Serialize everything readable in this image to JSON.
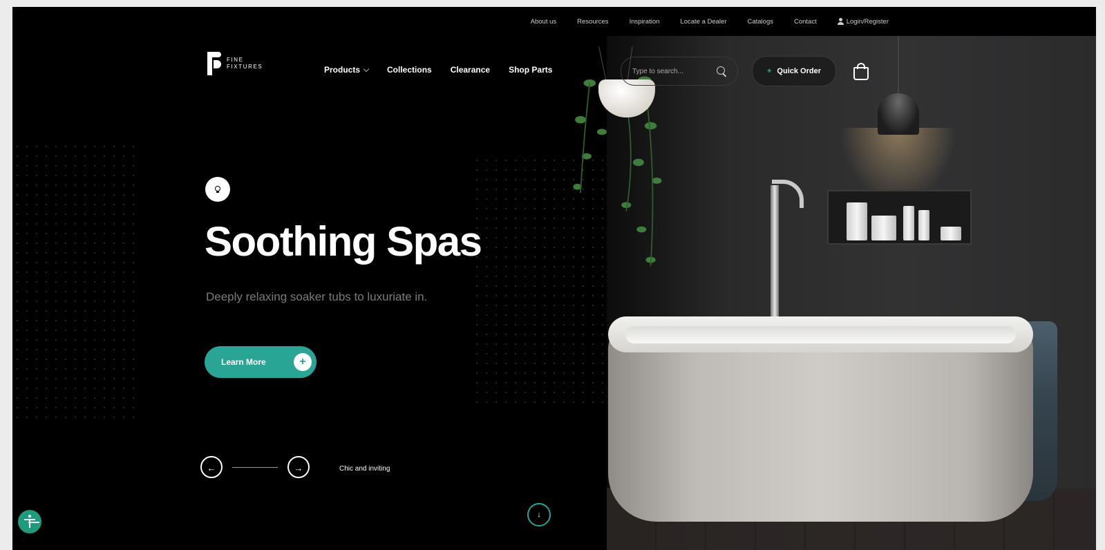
{
  "topbar": {
    "links": [
      "About us",
      "Resources",
      "Inspiration",
      "Locate a Dealer",
      "Catalogs",
      "Contact"
    ],
    "login": "Login/Register"
  },
  "logo": {
    "line1": "FINE",
    "line2": "FIXTURES"
  },
  "nav": {
    "items": [
      "Products",
      "Collections",
      "Clearance",
      "Shop Parts"
    ]
  },
  "search": {
    "placeholder": "Type to search..."
  },
  "quick_order": {
    "label": "Quick Order"
  },
  "hero": {
    "title": "Soothing Spas",
    "subtitle": "Deeply relaxing soaker tubs to luxuriate in.",
    "cta": "Learn More",
    "slide_caption": "Chic and inviting"
  },
  "colors": {
    "accent": "#28a595",
    "background": "#000000",
    "accessibility": "#1e9b7a"
  },
  "icons": [
    "user-icon",
    "search-icon",
    "bag-icon",
    "bulb-icon",
    "arrow-left-icon",
    "arrow-right-icon",
    "arrow-down-icon",
    "accessibility-icon",
    "plus-icon"
  ]
}
